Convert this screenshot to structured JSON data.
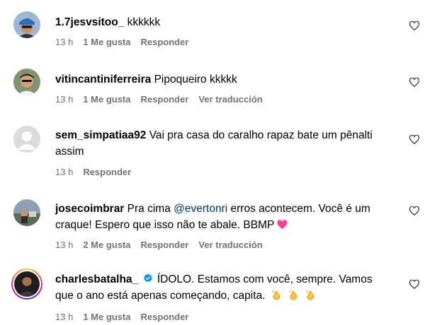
{
  "comments": [
    {
      "username": "1.7jesvsitoo_",
      "text": "kkkkkk",
      "time": "13 h",
      "likes": "1 Me gusta",
      "reply": "Responder",
      "translate": ""
    },
    {
      "username": "vitincantiniferreira",
      "text": "Pipoqueiro kkkkk",
      "time": "13 h",
      "likes": "1 Me gusta",
      "reply": "Responder",
      "translate": "Ver traducción"
    },
    {
      "username": "sem_simpatiaa92",
      "text": "Vai pra casa do caralho rapaz bate um pênalti assim",
      "time": "13 h",
      "likes": "",
      "reply": "Responder",
      "translate": ""
    },
    {
      "username": "josecoimbrar",
      "text_before": "Pra cima",
      "mention": "@evertonri",
      "text_after": "erros acontecem. Você é um craque! Espero que isso não te abale. BBMP",
      "emoji": "pink-heart",
      "time": "13 h",
      "likes": "2 Me gusta",
      "reply": "Responder",
      "translate": "Ver traducción"
    },
    {
      "username": "charlesbatalha_",
      "verified": true,
      "text": "ÍDOLO. Estamos com você, sempre. Vamos que o ano está apenas começando, capita.",
      "emoji": "clapping-hands x3",
      "time": "13 h",
      "likes": "1 Me gusta",
      "reply": "Responder",
      "translate": ""
    }
  ],
  "icons": {
    "like": "heart-outline-icon",
    "verified": "verified-badge-icon"
  },
  "colors": {
    "mention": "#00376b",
    "meta": "#737373",
    "verified": "#0095f6",
    "emoji_heart": "#f0458f",
    "emoji_clap": "#f7c33c"
  }
}
